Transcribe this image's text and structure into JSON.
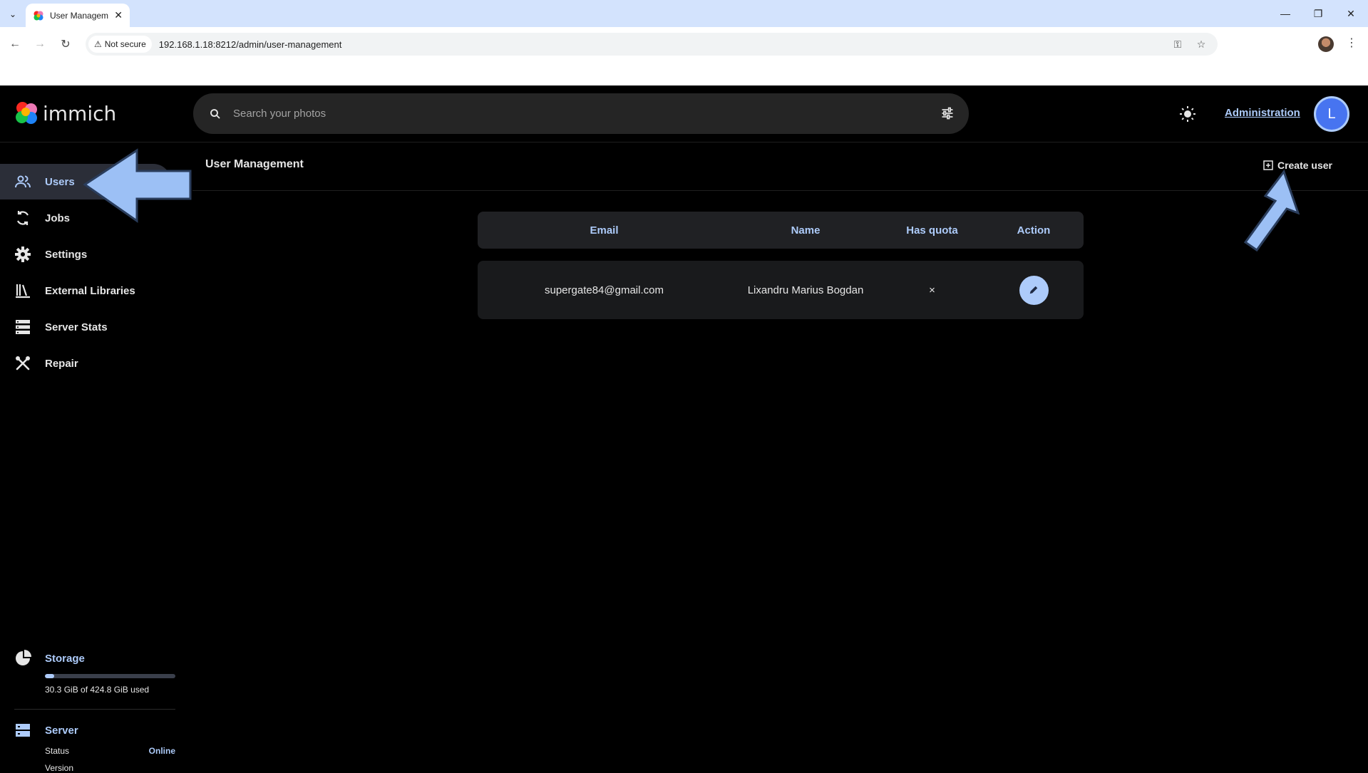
{
  "browser": {
    "tab_title": "User Managem",
    "security_label": "Not secure",
    "url": "192.168.1.18:8212/admin/user-management"
  },
  "app": {
    "logo_text": "immich",
    "search_placeholder": "Search your photos",
    "admin_link": "Administration",
    "avatar_initial": "L"
  },
  "sidebar": {
    "items": [
      {
        "label": "Users",
        "icon": "users-icon"
      },
      {
        "label": "Jobs",
        "icon": "sync-icon"
      },
      {
        "label": "Settings",
        "icon": "gear-icon"
      },
      {
        "label": "External Libraries",
        "icon": "library-icon"
      },
      {
        "label": "Server Stats",
        "icon": "server-icon"
      },
      {
        "label": "Repair",
        "icon": "tools-icon"
      }
    ],
    "storage": {
      "label": "Storage",
      "usage_text": "30.3 GiB of 424.8 GiB used",
      "used_fraction": 0.0713
    },
    "server": {
      "label": "Server",
      "status_key": "Status",
      "status_value": "Online",
      "version_key": "Version"
    }
  },
  "main": {
    "title": "User Management",
    "create_label": "Create user",
    "table": {
      "headers": [
        "Email",
        "Name",
        "Has quota",
        "Action"
      ],
      "rows": [
        {
          "email": "supergate84@gmail.com",
          "name": "Lixandru Marius Bogdan",
          "has_quota": "×"
        }
      ]
    }
  },
  "colors": {
    "accent": "#adcbfa",
    "background": "#000000",
    "avatar": "#4774f0",
    "annotation_arrow": "#9cc0f5"
  }
}
